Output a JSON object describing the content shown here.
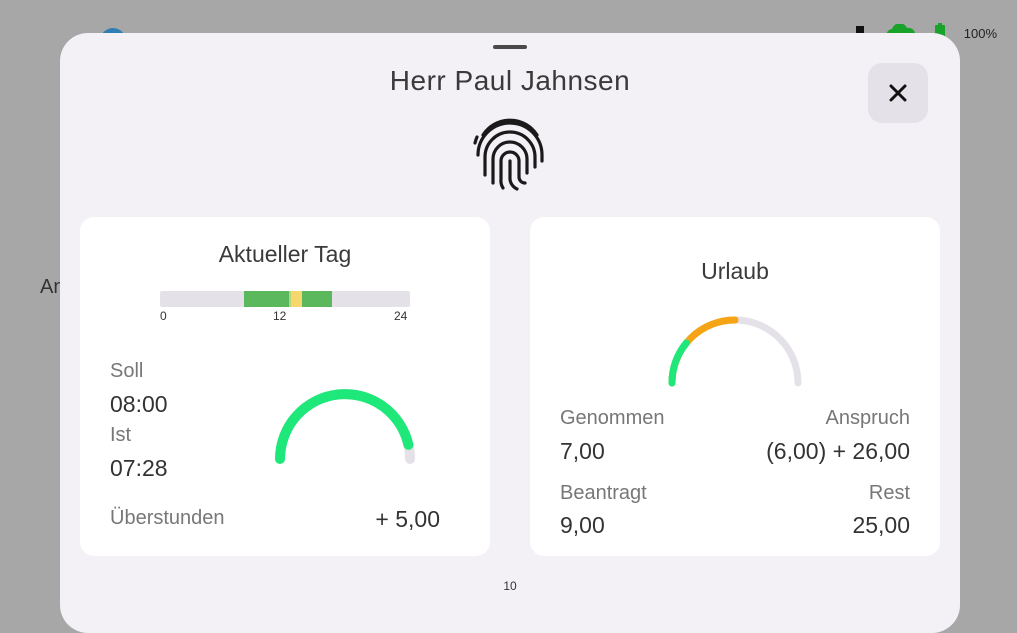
{
  "status": {
    "battery_pct": "100%"
  },
  "background": {
    "text": "An"
  },
  "sheet": {
    "title": "Herr Paul Jahnsen",
    "footer_number": "10"
  },
  "today": {
    "title": "Aktueller Tag",
    "ticks": [
      "0",
      "12",
      "24"
    ],
    "soll_label": "Soll",
    "soll_value": "08:00",
    "ist_label": "Ist",
    "ist_value": "07:28",
    "overtime_label": "Überstunden",
    "overtime_value": "+ 5,00",
    "gauge_fraction": 0.93
  },
  "vacation": {
    "title": "Urlaub",
    "taken_label": "Genommen",
    "taken_value": "7,00",
    "entitlement_label": "Anspruch",
    "entitlement_value": "(6,00) + 26,00",
    "requested_label": "Beantragt",
    "requested_value": "9,00",
    "rest_label": "Rest",
    "rest_value": "25,00"
  },
  "colors": {
    "accent_green": "#1ee87a",
    "bar_green": "#5cb85c",
    "bar_yellow": "#f5d76e",
    "gauge_orange": "#f4a414",
    "track_grey": "#e4e2e8"
  }
}
